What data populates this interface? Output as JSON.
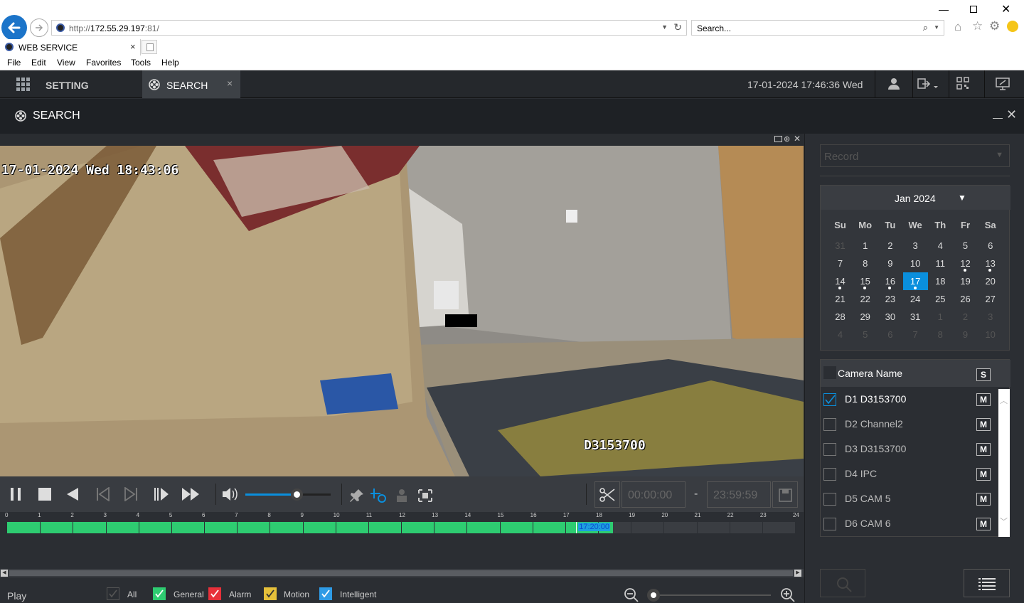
{
  "browser": {
    "url_prefix": "http://",
    "url_host": "172.55.29.197",
    "url_suffix": ":81/",
    "search_placeholder": "Search...",
    "tab_title": "WEB SERVICE",
    "menu": [
      "File",
      "Edit",
      "View",
      "Favorites",
      "Tools",
      "Help"
    ]
  },
  "app": {
    "setting_label": "SETTING",
    "search_tab_label": "SEARCH",
    "datetime": "17-01-2024 17:46:36 Wed",
    "page_title": "SEARCH"
  },
  "video": {
    "osd_timestamp": "17-01-2024 Wed 18:43:06",
    "osd_camera": "D3153700"
  },
  "controls": {
    "volume_level": 0.6,
    "clip_start": "00:00:00",
    "clip_separator": "-",
    "clip_end": "23:59:59"
  },
  "timeline": {
    "hours": [
      "0",
      "1",
      "2",
      "3",
      "4",
      "5",
      "6",
      "7",
      "8",
      "9",
      "10",
      "11",
      "12",
      "13",
      "14",
      "15",
      "16",
      "17",
      "18",
      "19",
      "20",
      "21",
      "22",
      "23",
      "24"
    ],
    "recorded_until_hour": 18.45,
    "cursor_time": "17:20:00"
  },
  "legend": {
    "play_label": "Play",
    "items": [
      {
        "label": "All",
        "color": "#2b2e33"
      },
      {
        "label": "General",
        "color": "#2ecc71"
      },
      {
        "label": "Alarm",
        "color": "#e8303a"
      },
      {
        "label": "Motion",
        "color": "#e6c03a"
      },
      {
        "label": "Intelligent",
        "color": "#2e9be6"
      }
    ]
  },
  "right_panel": {
    "record_type_placeholder": "Record",
    "calendar": {
      "month_label": "Jan 2024",
      "weekdays": [
        "Su",
        "Mo",
        "Tu",
        "We",
        "Th",
        "Fr",
        "Sa"
      ],
      "weeks": [
        [
          "31",
          "1",
          "2",
          "3",
          "4",
          "5",
          "6"
        ],
        [
          "7",
          "8",
          "9",
          "10",
          "11",
          "12",
          "13"
        ],
        [
          "14",
          "15",
          "16",
          "17",
          "18",
          "19",
          "20"
        ],
        [
          "21",
          "22",
          "23",
          "24",
          "25",
          "26",
          "27"
        ],
        [
          "28",
          "29",
          "30",
          "31",
          "1",
          "2",
          "3"
        ],
        [
          "4",
          "5",
          "6",
          "7",
          "8",
          "9",
          "10"
        ]
      ],
      "selected_day": "17",
      "days_with_records": [
        "12",
        "13",
        "14",
        "15",
        "16",
        "17"
      ]
    },
    "camera_header": "Camera Name",
    "s_button": "S",
    "m_button": "M",
    "cameras": [
      {
        "name": "D1 D3153700",
        "checked": true
      },
      {
        "name": "D2 Channel2",
        "checked": false
      },
      {
        "name": "D3 D3153700",
        "checked": false
      },
      {
        "name": "D4 IPC",
        "checked": false
      },
      {
        "name": "D5 CAM 5",
        "checked": false
      },
      {
        "name": "D6 CAM 6",
        "checked": false
      }
    ]
  }
}
